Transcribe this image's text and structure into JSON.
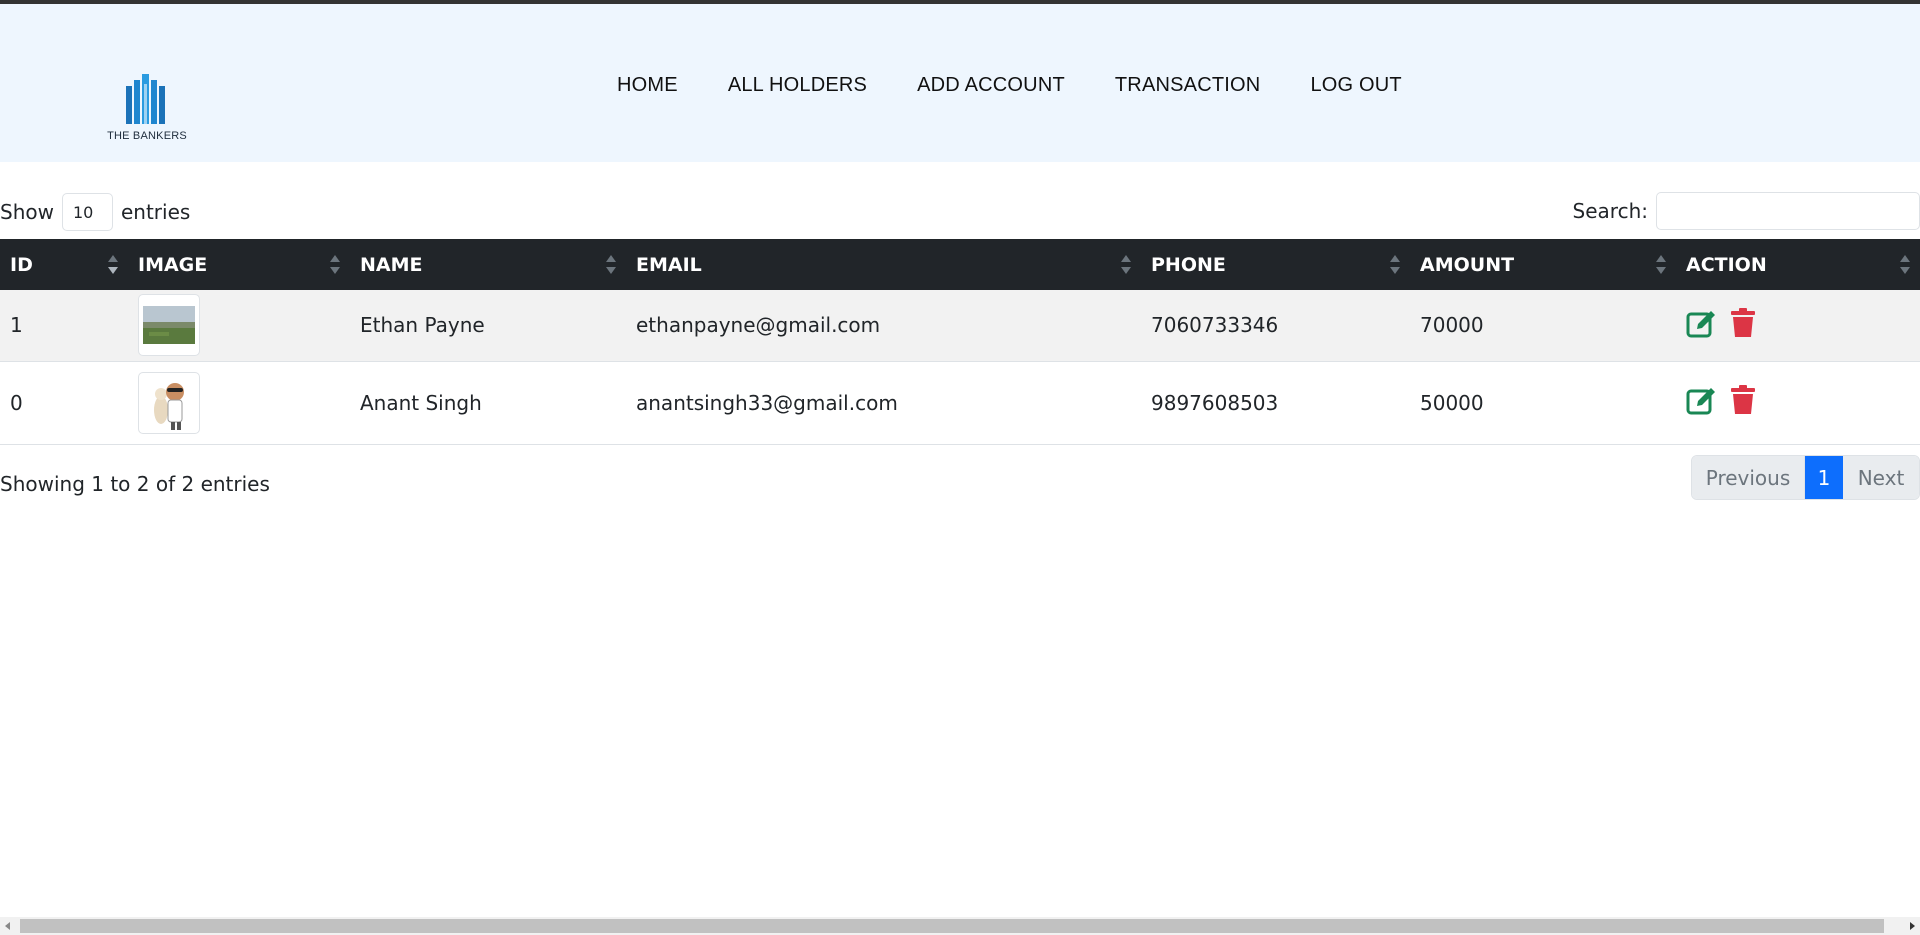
{
  "brand": {
    "name": "THE BANKERS",
    "colors": {
      "primary": "#0d6efd",
      "edit": "#198754",
      "delete": "#dc3545",
      "header_bg": "#eef6fe",
      "table_head": "#212529"
    }
  },
  "nav": {
    "items": [
      {
        "label": "HOME"
      },
      {
        "label": "ALL HOLDERS"
      },
      {
        "label": "ADD ACCOUNT"
      },
      {
        "label": "TRANSACTION"
      },
      {
        "label": "LOG OUT"
      }
    ]
  },
  "controls": {
    "show_label": "Show",
    "entries_value": "10",
    "entries_label": "entries",
    "search_label": "Search:",
    "search_value": ""
  },
  "table": {
    "headers": [
      "ID",
      "IMAGE",
      "NAME",
      "EMAIL",
      "PHONE",
      "AMOUNT",
      "ACTION"
    ],
    "rows": [
      {
        "id": "1",
        "image": "landscape-photo",
        "name": "Ethan Payne",
        "email": "ethanpayne@gmail.com",
        "phone": "7060733346",
        "amount": "70000"
      },
      {
        "id": "0",
        "image": "avatar-cartoon",
        "name": "Anant Singh",
        "email": "anantsingh33@gmail.com",
        "phone": "9897608503",
        "amount": "50000"
      }
    ],
    "action_icons": [
      "edit-icon",
      "trash-icon"
    ]
  },
  "footer": {
    "info": "Showing 1 to 2 of 2 entries",
    "pagination": {
      "previous": "Previous",
      "current": "1",
      "next": "Next"
    }
  }
}
